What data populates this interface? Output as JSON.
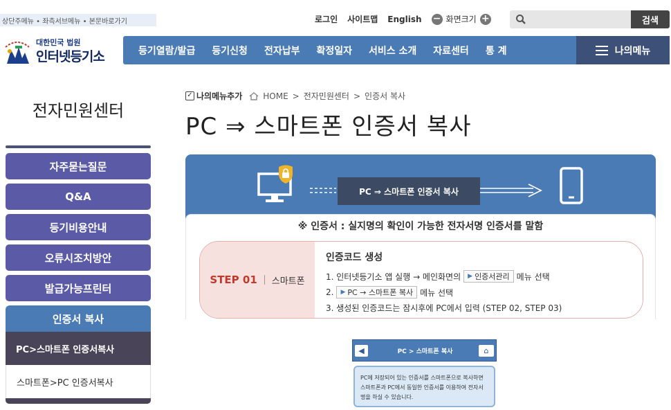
{
  "skip_links": "상단주메뉴 • 좌측서브메뉴 • 본문바로가기",
  "util": {
    "login": "로그인",
    "sitemap": "사이트맵",
    "english": "English",
    "zoom_label": "화면크기",
    "zoom_out": "−",
    "zoom_in": "+"
  },
  "search": {
    "placeholder": "",
    "button": "검색",
    "icon": "search-icon"
  },
  "logo": {
    "sub": "대한민국 법원",
    "main": "인터넷등기소",
    "emblem_icon": "court-emblem-icon"
  },
  "gnb": [
    "등기열람/발급",
    "등기신청",
    "전자납부",
    "확정일자",
    "서비스 소개",
    "자료센터",
    "통 계"
  ],
  "my_menu": "나의메뉴",
  "sidebar": {
    "title": "전자민원센터",
    "items": [
      "자주묻는질문",
      "Q&A",
      "등기비용안내",
      "오류시조치방안",
      "발급가능프린터"
    ],
    "active": "인증서 복사",
    "subitems": [
      "PC>스마트폰 인증서복사",
      "스마트폰>PC 인증서복사"
    ]
  },
  "breadcrumb": {
    "add": "나의메뉴추가",
    "home": "HOME",
    "sep": ">",
    "level1": "전자민원센터",
    "level2": "인증서 복사"
  },
  "page_title": "PC ⇒ 스마트폰 인증서 복사",
  "diagram": {
    "label": "PC ⇒ 스마트폰 인증서 복사"
  },
  "notice": "※ 인증서 : 실지명의 확인이 가능한 전자서명 인증서를 말함",
  "step": {
    "number": "STEP 01",
    "actor": "스마트폰",
    "heading": "인증코드 생성",
    "line1_pre": "1. 인터넷등기소 앱 실행 → 메인화면의",
    "line1_chip": "인증서관리",
    "line1_post": "메뉴 선택",
    "line2_pre": "2.",
    "line2_chip": "PC → 스마트폰 복사",
    "line2_post": "메뉴 선택",
    "line3": "3. 생성된 인증코드는 잠시후에 PC에서 입력 (STEP 02, STEP 03)"
  },
  "phone": {
    "title": "PC > 스마트폰 복사",
    "back": "◀",
    "home": "⌂",
    "body": "PC에 저장되어 있는 인증서를 스마트폰으로 복사하면 스마트폰과 PC에서 동일한 인증서를 이용하여 전자서명을 하실 수 있습니다."
  },
  "colors": {
    "nav": "#4a7bb5",
    "my_menu": "#3c5078",
    "lnb": "#5a5aa7",
    "step": "#c0392b"
  }
}
